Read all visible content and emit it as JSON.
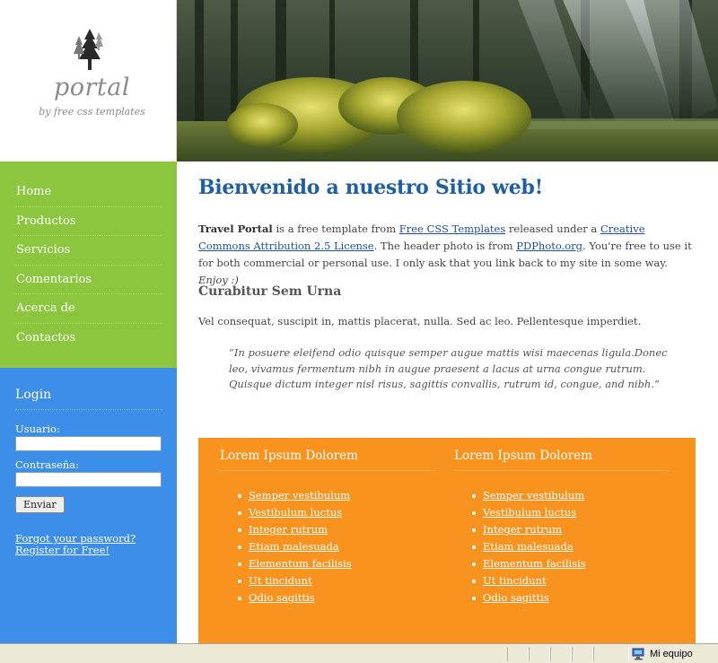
{
  "logo": {
    "title": "portal",
    "subtitle": "by free css templates"
  },
  "nav": {
    "items": [
      {
        "label": "Home"
      },
      {
        "label": "Productos"
      },
      {
        "label": "Servicios"
      },
      {
        "label": "Comentarios"
      },
      {
        "label": "Acerca de"
      },
      {
        "label": "Contactos"
      }
    ]
  },
  "login": {
    "title": "Login",
    "user_label": "Usuario:",
    "user_value": "",
    "pass_label": "Contraseña:",
    "pass_value": "",
    "submit": "Enviar",
    "forgot": "Forgot your password?",
    "register": "Register for Free!"
  },
  "main": {
    "welcome": "Bienvenido a nuestro Sitio web!",
    "intro": {
      "brand": "Travel Portal",
      "t1": " is a free template from ",
      "link1": "Free CSS Templates",
      "t2": " released under a ",
      "link2": "Creative Commons Attribution 2.5 License",
      "t3": ". The header photo is from ",
      "link3": "PDPhoto.org",
      "t4": ". You're free to use it for both commercial or personal use. I only ask that you link back to my site in some way. ",
      "enjoy": "Enjoy :)"
    },
    "subtitle": "Curabitur Sem Urna",
    "subtext": "Vel consequat, suscipit in, mattis placerat, nulla. Sed ac leo. Pellentesque imperdiet.",
    "quote": "“In posuere eleifend odio quisque semper augue mattis wisi maecenas ligula.Donec leo, vivamus fermentum nibh in augue praesent a lacus at urna congue rutrum. Quisque dictum integer nisl risus, sagittis convallis, rutrum id, congue, and nibh.”"
  },
  "boxes": [
    {
      "title": "Lorem Ipsum Dolorem",
      "links": [
        "Semper vestibulum",
        "Vestibulum luctus",
        "Integer rutrum",
        "Etiam malesuada",
        "Elementum facilisis",
        "Ut tincidunt",
        "Odio sagittis"
      ]
    },
    {
      "title": "Lorem Ipsum Dolorem",
      "links": [
        "Semper vestibulum",
        "Vestibulum luctus",
        "Integer rutrum",
        "Etiam malesuada",
        "Elementum facilisis",
        "Ut tincidunt",
        "Odio sagittis"
      ]
    }
  ],
  "statusbar": {
    "zone": "Mi equipo"
  },
  "colors": {
    "nav_bg": "#8cc63f",
    "login_bg": "#3d8ee8",
    "box_bg": "#f7931e",
    "heading": "#1f5fa0"
  }
}
